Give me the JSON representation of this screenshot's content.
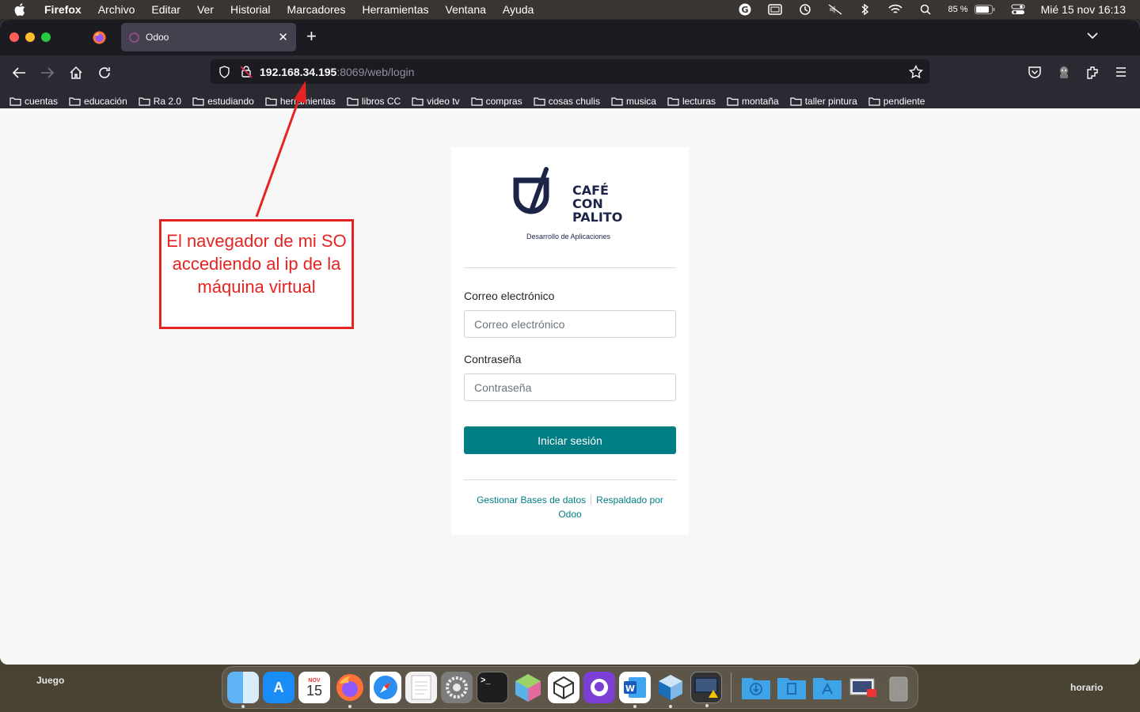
{
  "menubar": {
    "items": [
      "Firefox",
      "Archivo",
      "Editar",
      "Ver",
      "Historial",
      "Marcadores",
      "Herramientas",
      "Ventana",
      "Ayuda"
    ],
    "battery": "85 %",
    "clock": "Mié 15 nov  16:13",
    "icons": [
      "grammarly-icon",
      "screen-mirror-icon",
      "time-machine-icon",
      "mute-icon",
      "bluetooth-icon",
      "wifi-icon",
      "search-icon",
      "battery-icon",
      "control-center-icon"
    ]
  },
  "browser": {
    "tab_title": "Odoo",
    "url_host": "192.168.34.195",
    "url_rest": ":8069/web/login",
    "bookmarks": [
      "cuentas",
      "educación",
      "Ra 2.0",
      "estudiando",
      "herramientas",
      "libros CC",
      "video tv",
      "compras",
      "cosas chulis",
      "musica",
      "lecturas",
      "montaña",
      "taller pintura",
      "pendiente"
    ]
  },
  "login": {
    "logo_lines": [
      "CAFÉ",
      "CON",
      "PALITO"
    ],
    "logo_subtitle": "Desarrollo de Aplicaciones",
    "email_label": "Correo electrónico",
    "email_placeholder": "Correo electrónico",
    "password_label": "Contraseña",
    "password_placeholder": "Contraseña",
    "submit_label": "Iniciar sesión",
    "link_manage_db": "Gestionar Bases de datos",
    "link_powered_1": "Respaldado por",
    "link_powered_2": "Odoo",
    "accent_color": "#017e84"
  },
  "annotation": {
    "text": "El navegador de mi SO accediendo al ip de la máquina virtual",
    "color": "#e52421"
  },
  "desktop": {
    "label_left": "Juego",
    "label_right": "horario",
    "calendar_month": "NOV",
    "calendar_day": "15"
  }
}
